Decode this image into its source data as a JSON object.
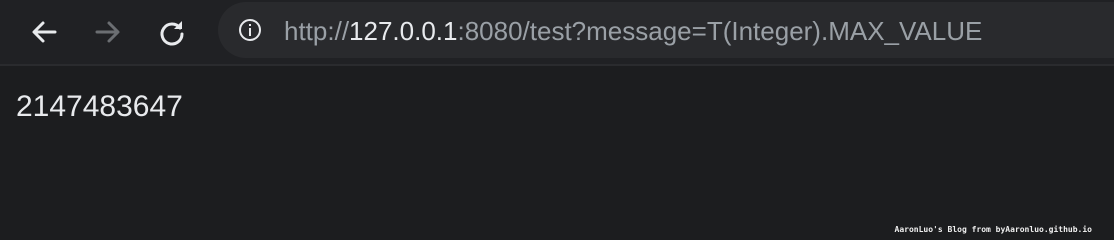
{
  "browser": {
    "back_icon": "arrow-left-icon",
    "forward_icon": "arrow-right-icon",
    "reload_icon": "reload-icon",
    "site_info_icon": "info-circle-icon",
    "url": {
      "scheme": "http://",
      "host": "127.0.0.1",
      "rest": ":8080/test?message=T(Integer).MAX_VALUE"
    }
  },
  "page": {
    "body_text": "2147483647"
  },
  "watermark": {
    "text": "AaronLuo's Blog from byAaronluo.github.io"
  }
}
